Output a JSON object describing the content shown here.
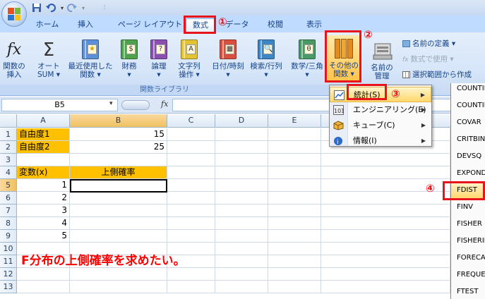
{
  "tabs": [
    "ホーム",
    "挿入",
    "ページ レイアウト",
    "数式",
    "データ",
    "校閲",
    "表示"
  ],
  "ribbon": {
    "insert_fn": [
      "関数の",
      "挿入"
    ],
    "autosum": [
      "オート",
      "SUM ▾"
    ],
    "recent": [
      "最近使用した",
      "関数 ▾"
    ],
    "finance": [
      "財務",
      "▾"
    ],
    "logic": [
      "論理",
      "▾"
    ],
    "text": [
      "文字列",
      "操作 ▾"
    ],
    "datetime": [
      "日付/時刻",
      "▾"
    ],
    "lookup": [
      "検索/行列",
      "▾"
    ],
    "math": [
      "数学/三角",
      "▾"
    ],
    "other": [
      "その他の",
      "関数 ▾"
    ],
    "namemgr": [
      "名前の",
      "管理"
    ],
    "define_name": "名前の定義 ▾",
    "use_in_formula": "数式で使用 ▾",
    "create_from_sel": "選択範囲から作成",
    "group_label": "関数ライブラリ",
    "icon_letters": {
      "finance": "$",
      "logic": "?",
      "text": "A",
      "math": "θ"
    }
  },
  "formula_bar": {
    "namebox": "B5",
    "fx": "fx"
  },
  "columns": [
    "A",
    "B",
    "C",
    "D",
    "E"
  ],
  "rows": [
    "1",
    "2",
    "3",
    "4",
    "5",
    "6",
    "7",
    "8",
    "9",
    "10",
    "11",
    "12",
    "13"
  ],
  "cells": {
    "A1": "自由度1",
    "B1": "15",
    "A2": "自由度2",
    "B2": "25",
    "A4": "変数(x)",
    "B4": "上側確率",
    "A5": "1",
    "A6": "2",
    "A7": "3",
    "A8": "4",
    "A9": "5"
  },
  "note": "F分布の上側確率を求めたい。",
  "menu": [
    {
      "label": "統計(S)",
      "icon": "chart-icon"
    },
    {
      "label": "エンジニアリング(E)",
      "icon": "engineering-icon"
    },
    {
      "label": "キューブ(C)",
      "icon": "cube-icon"
    },
    {
      "label": "情報(I)",
      "icon": "info-icon"
    }
  ],
  "submenu": [
    "COUNTIF",
    "COUNTIFS",
    "COVAR",
    "CRITBINOM",
    "DEVSQ",
    "EXPONDIST",
    "FDIST",
    "FINV",
    "FISHER",
    "FISHERINV",
    "FORECAST",
    "FREQUENCY",
    "FTEST"
  ],
  "annotations": [
    "①",
    "②",
    "③",
    "④"
  ],
  "colors": {
    "highlight": "#e8131b",
    "orange": "#ffc000",
    "note": "#ff0000"
  }
}
